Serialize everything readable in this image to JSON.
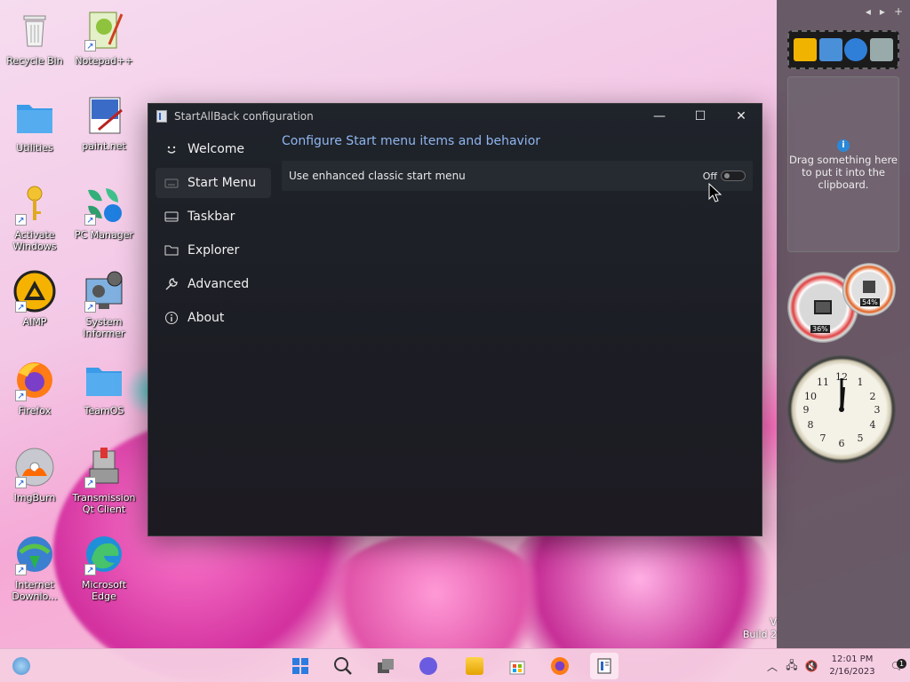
{
  "desktop": {
    "icons": [
      {
        "label": "Recycle Bin"
      },
      {
        "label": "Notepad++"
      },
      {
        "label": "Utilities"
      },
      {
        "label": "paint.net"
      },
      {
        "label": "Activate Windows"
      },
      {
        "label": "PC Manager"
      },
      {
        "label": "AIMP"
      },
      {
        "label": "System Informer"
      },
      {
        "label": "Firefox"
      },
      {
        "label": "TeamOS"
      },
      {
        "label": "ImgBurn"
      },
      {
        "label": "Transmission Qt Client"
      },
      {
        "label": "Internet Downlo..."
      },
      {
        "label": "Microsoft Edge"
      }
    ],
    "watermark": {
      "line1": "V",
      "line2": "Build 2"
    }
  },
  "gadgets": {
    "controls": {
      "prev": "◂",
      "next": "▸",
      "add": "+"
    },
    "clipboard_text": "Drag something here to put it into the clipboard.",
    "cpu_percent": "36%",
    "ram_percent": "54%",
    "clock_numbers": [
      "12",
      "1",
      "2",
      "3",
      "4",
      "5",
      "6",
      "7",
      "8",
      "9",
      "10",
      "11"
    ]
  },
  "window": {
    "title": "StartAllBack configuration",
    "minimize": "—",
    "maximize": "☐",
    "close": "✕",
    "nav": [
      {
        "label": "Welcome",
        "icon": "smile-icon"
      },
      {
        "label": "Start Menu",
        "icon": "keyboard-icon"
      },
      {
        "label": "Taskbar",
        "icon": "taskbar-icon"
      },
      {
        "label": "Explorer",
        "icon": "folder-icon"
      },
      {
        "label": "Advanced",
        "icon": "wrench-icon"
      },
      {
        "label": "About",
        "icon": "info-icon"
      }
    ],
    "active_nav": "Start Menu",
    "section_title": "Configure Start menu items and behavior",
    "settings": [
      {
        "label": "Use enhanced classic start menu",
        "state": "Off"
      }
    ]
  },
  "taskbar": {
    "time": "12:01 PM",
    "date": "2/16/2023",
    "notification_count": "1"
  }
}
